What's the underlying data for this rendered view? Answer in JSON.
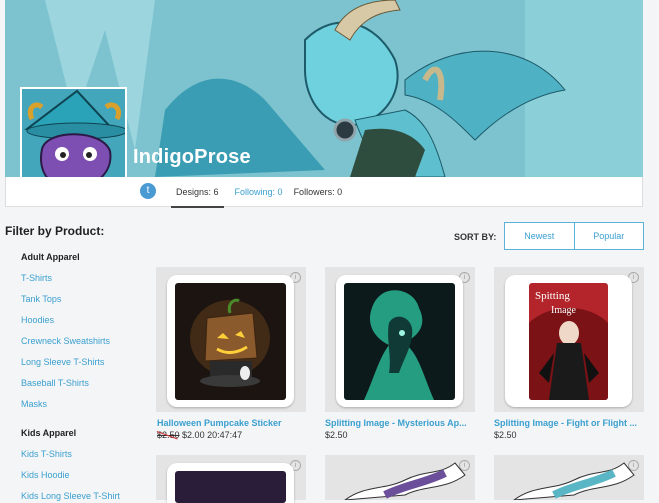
{
  "profile": {
    "username": "IndigoProse",
    "stats": {
      "designs": "Designs: 6",
      "following": "Following: 0",
      "followers": "Followers: 0"
    }
  },
  "filter": {
    "title": "Filter by Product:",
    "adult_title": "Adult Apparel",
    "adult": [
      "T-Shirts",
      "Tank Tops",
      "Hoodies",
      "Crewneck Sweatshirts",
      "Long Sleeve T-Shirts",
      "Baseball T-Shirts",
      "Masks"
    ],
    "kids_title": "Kids Apparel",
    "kids": [
      "Kids T-Shirts",
      "Kids Hoodie",
      "Kids Long Sleeve T-Shirt"
    ]
  },
  "sort": {
    "label": "SORT BY:",
    "newest": "Newest",
    "popular": "Popular"
  },
  "products": [
    {
      "title": "Halloween Pumpcake Sticker",
      "old_price": "$2.50",
      "price": "$2.00 20:47:47"
    },
    {
      "title": "Splitting Image - Mysterious Ap...",
      "price": "$2.50"
    },
    {
      "title": "Splitting Image - Fight or Flight ...",
      "price": "$2.50"
    }
  ],
  "icons": {
    "twitter": "twitter-icon",
    "info": "info-icon"
  },
  "colors": {
    "accent": "#3a9fd0",
    "banner": "#6fbac9"
  }
}
